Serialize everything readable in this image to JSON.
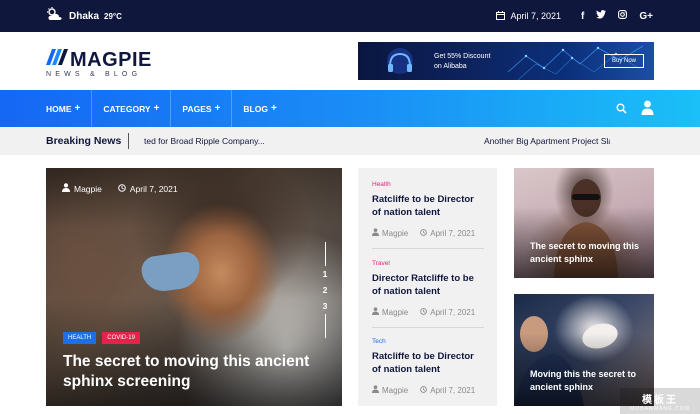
{
  "topbar": {
    "city": "Dhaka",
    "temperature": "29°C",
    "date": "April 7, 2021",
    "social": [
      {
        "icon": "facebook-icon",
        "glyph": "f"
      },
      {
        "icon": "twitter-icon",
        "glyph": "🐦"
      },
      {
        "icon": "instagram-icon",
        "glyph": "◎"
      },
      {
        "icon": "google-plus-icon",
        "glyph": "G+"
      }
    ]
  },
  "header": {
    "logo_name": "MAGPIE",
    "logo_tagline": "NEWS & BLOG",
    "ad": {
      "line1": "Get 55% Discount",
      "line2": "on Alibaba",
      "button": "Buy Now"
    }
  },
  "nav": {
    "items": [
      {
        "label": "HOME"
      },
      {
        "label": "CATEGORY"
      },
      {
        "label": "PAGES"
      },
      {
        "label": "BLOG"
      }
    ],
    "plus": "+"
  },
  "breaking": {
    "label": "Breaking News",
    "ticker": [
      "ted for Broad Ripple Company...",
      "Another Big Apartment Project Sla"
    ]
  },
  "feature": {
    "author": "Magpie",
    "date": "April 7, 2021",
    "pages": [
      "1",
      "2",
      "3"
    ],
    "tags": [
      "HEALTH",
      "COVID-19"
    ],
    "title": "The secret to moving this ancient sphinx screening"
  },
  "middle": {
    "items": [
      {
        "category": "Health",
        "category_color": "#e5227a",
        "title": "Ratcliffe to be Director of nation talent",
        "author": "Magpie",
        "date": "April 7, 2021"
      },
      {
        "category": "Travel",
        "category_color": "#e5227a",
        "title": "Director Ratcliffe to be of nation talent",
        "author": "Magpie",
        "date": "April 7, 2021"
      },
      {
        "category": "Tech",
        "category_color": "#1e6fe5",
        "title": "Ratcliffe to be Director of nation talent",
        "author": "Magpie",
        "date": "April 7, 2021"
      }
    ]
  },
  "cards": [
    {
      "title": "The secret to moving this ancient sphinx"
    },
    {
      "title": "Moving this the secret to ancient sphinx"
    }
  ],
  "watermark": {
    "main": "模板王",
    "sub": "MOBANWANG.COM"
  },
  "colors": {
    "topbar": "#10173d",
    "accent_blue": "#1567f4",
    "accent_cyan": "#1ac0f7",
    "tag_health": "#1e6fe5",
    "tag_covid": "#e5224a"
  }
}
